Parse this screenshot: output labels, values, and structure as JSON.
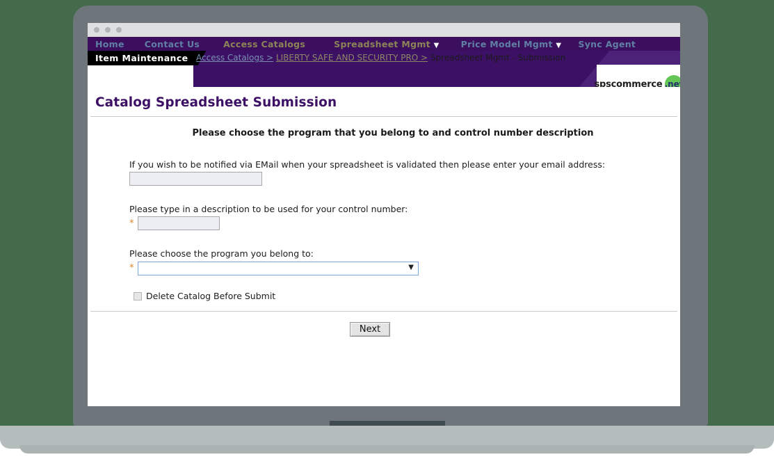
{
  "window": {
    "dots": [
      "dot-1",
      "dot-2",
      "dot-3"
    ]
  },
  "nav": {
    "items": [
      {
        "label": "Home",
        "style": "blue",
        "caret": ""
      },
      {
        "label": "Contact Us",
        "style": "blue",
        "caret": ""
      },
      {
        "label": "Access Catalogs",
        "style": "olive",
        "caret": ""
      },
      {
        "label": "Spreadsheet Mgmt",
        "style": "olive",
        "caret": "▼"
      },
      {
        "label": "Price Model Mgmt",
        "style": "blue",
        "caret": "▼"
      },
      {
        "label": "Sync Agent",
        "style": "blue",
        "caret": ""
      }
    ]
  },
  "tab": {
    "label": "Item Maintenance"
  },
  "breadcrumb": {
    "link1": "Access Catalogs >",
    "link2": "LIBERTY SAFE AND SECURITY PRO >",
    "current": "Spreadsheet Mgmt - Submission"
  },
  "logo": {
    "name": "spscommerce",
    "badge": ".net"
  },
  "page": {
    "title": "Catalog Spreadsheet Submission",
    "subtitle": "Please choose the program that you belong to and control number description"
  },
  "form": {
    "email": {
      "label": "If you wish to be notified via EMail when your spreadsheet is validated then please enter your email address:",
      "value": "",
      "placeholder": ""
    },
    "control_number": {
      "label": "Please type in a description to be used for your control number:",
      "required_marker": "*",
      "value": "",
      "placeholder": ""
    },
    "program": {
      "label": "Please choose the program you belong to:",
      "required_marker": "*",
      "selected": "",
      "caret": "▼",
      "options": [
        ""
      ]
    },
    "delete_catalog": {
      "label": "Delete Catalog Before Submit",
      "checked": false
    },
    "next_button": "Next"
  },
  "colors": {
    "nav_purple": "#3c0f5e",
    "band_purple": "#3c1165",
    "band_slant": "#4c2278",
    "title_purple": "#3c1165",
    "nav_blue": "#5f7fa3",
    "nav_olive": "#8a8457",
    "required_orange": "#e0872e",
    "badge_green": "#63c656",
    "backdrop_green": "#446a4c",
    "laptop_gray": "#6e767b",
    "laptop_base_gray": "#b4bcbc"
  }
}
